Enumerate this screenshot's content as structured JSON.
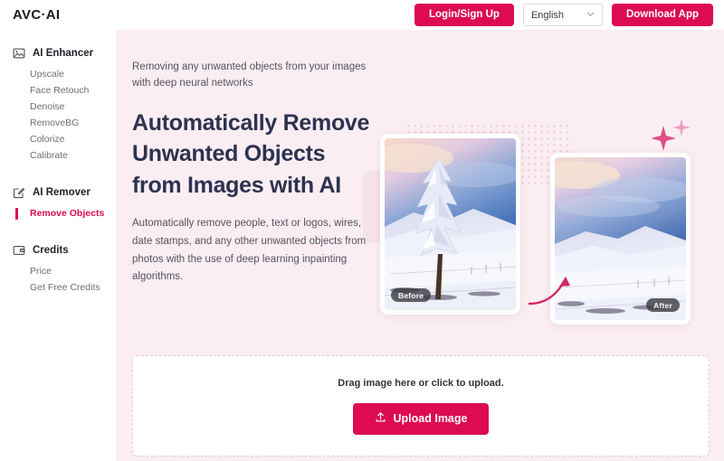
{
  "colors": {
    "accent": "#DC0B52",
    "main_bg": "#FBEEF2",
    "sidebar_bg": "#FFFFFF",
    "heading": "#2D3250",
    "body_text": "#53535E"
  },
  "header": {
    "logo": "AVC·AI",
    "login_label": "Login/Sign Up",
    "language_value": "English",
    "download_label": "Download App"
  },
  "sidebar": {
    "groups": [
      {
        "icon": "image-icon",
        "label": "AI Enhancer",
        "items": [
          {
            "label": "Upscale",
            "active": false
          },
          {
            "label": "Face Retouch",
            "active": false
          },
          {
            "label": "Denoise",
            "active": false
          },
          {
            "label": "RemoveBG",
            "active": false
          },
          {
            "label": "Colorize",
            "active": false
          },
          {
            "label": "Calibrate",
            "active": false
          }
        ]
      },
      {
        "icon": "edit-icon",
        "label": "AI Remover",
        "items": [
          {
            "label": "Remove Objects",
            "active": true
          }
        ]
      },
      {
        "icon": "wallet-icon",
        "label": "Credits",
        "items": [
          {
            "label": "Price",
            "active": false
          },
          {
            "label": "Get Free Credits",
            "active": false
          }
        ]
      }
    ]
  },
  "hero": {
    "eyebrow": "Removing any unwanted objects from your images with deep neural networks",
    "headline": "Automatically Remove Unwanted Objects from Images with AI",
    "lede": "Automatically remove people, text or logos, wires, date stamps, and any other unwanted objects from photos with the use of deep learning inpainting algorithms.",
    "before_badge": "Before",
    "after_badge": "After"
  },
  "upload": {
    "drag_text": "Drag image here or click to upload.",
    "button_label": "Upload Image",
    "button_icon": "upload-icon"
  }
}
